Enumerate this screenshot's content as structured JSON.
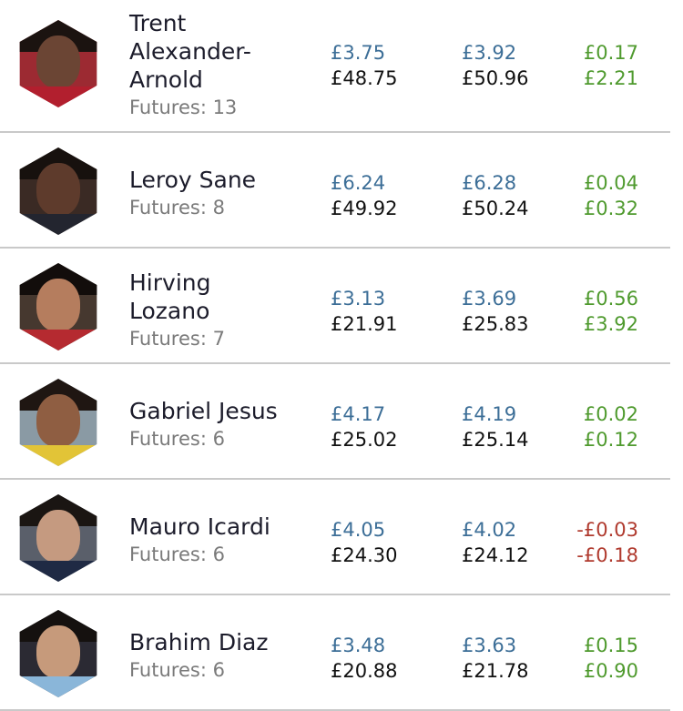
{
  "players": [
    {
      "name": "Trent\nAlexander-\nArnold",
      "futures": "Futures: 13",
      "buy_unit": "£3.75",
      "buy_total": "£48.75",
      "sell_unit": "£3.92",
      "sell_total": "£50.96",
      "diff_unit": "£0.17",
      "diff_total": "£2.21",
      "trend": "up",
      "avatar": {
        "bg": "#9c2a32",
        "hair": "#1b1310",
        "skin": "#6b4534",
        "shirt": "#b21f2e"
      }
    },
    {
      "name": "Leroy Sane",
      "futures": "Futures: 8",
      "buy_unit": "£6.24",
      "buy_total": "£49.92",
      "sell_unit": "£6.28",
      "sell_total": "£50.24",
      "diff_unit": "£0.04",
      "diff_total": "£0.32",
      "trend": "up",
      "avatar": {
        "bg": "#3a2a24",
        "hair": "#17110e",
        "skin": "#5e3b2c",
        "shirt": "#23252f"
      }
    },
    {
      "name": "Hirving\nLozano",
      "futures": "Futures: 7",
      "buy_unit": "£3.13",
      "buy_total": "£21.91",
      "sell_unit": "£3.69",
      "sell_total": "£25.83",
      "diff_unit": "£0.56",
      "diff_total": "£3.92",
      "trend": "up",
      "avatar": {
        "bg": "#46382f",
        "hair": "#120d0b",
        "skin": "#b57d5e",
        "shirt": "#b52a30"
      }
    },
    {
      "name": "Gabriel Jesus",
      "futures": "Futures: 6",
      "buy_unit": "£4.17",
      "buy_total": "£25.02",
      "sell_unit": "£4.19",
      "sell_total": "£25.14",
      "diff_unit": "£0.02",
      "diff_total": "£0.12",
      "trend": "up",
      "avatar": {
        "bg": "#8a9aa4",
        "hair": "#1f1612",
        "skin": "#8f5e42",
        "shirt": "#e2c437"
      }
    },
    {
      "name": "Mauro Icardi",
      "futures": "Futures: 6",
      "buy_unit": "£4.05",
      "buy_total": "£24.30",
      "sell_unit": "£4.02",
      "sell_total": "£24.12",
      "diff_unit": "-£0.03",
      "diff_total": "-£0.18",
      "trend": "down",
      "avatar": {
        "bg": "#5a5f6a",
        "hair": "#1a1512",
        "skin": "#c59a80",
        "shirt": "#1f2a44"
      }
    },
    {
      "name": "Brahim Diaz",
      "futures": "Futures: 6",
      "buy_unit": "£3.48",
      "buy_total": "£20.88",
      "sell_unit": "£3.63",
      "sell_total": "£21.78",
      "diff_unit": "£0.15",
      "diff_total": "£0.90",
      "trend": "up",
      "avatar": {
        "bg": "#2b2a33",
        "hair": "#15110f",
        "skin": "#c69a7b",
        "shirt": "#8ab6d9"
      }
    }
  ]
}
